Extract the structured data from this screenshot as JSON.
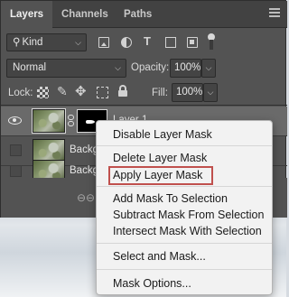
{
  "tabs": [
    {
      "label": "Layers",
      "active": true
    },
    {
      "label": "Channels",
      "active": false
    },
    {
      "label": "Paths",
      "active": false
    }
  ],
  "filter": {
    "kind_label": "Kind",
    "search_icon": "search-icon"
  },
  "blend": {
    "mode": "Normal",
    "opacity_label": "Opacity:",
    "opacity_value": "100%"
  },
  "lock": {
    "label": "Lock:",
    "fill_label": "Fill:",
    "fill_value": "100%"
  },
  "layers": [
    {
      "name": "Layer 1",
      "visible": true,
      "selected": true,
      "has_mask": true
    },
    {
      "name": "Backg",
      "visible": false,
      "selected": false,
      "has_mask": false
    },
    {
      "name": "Backg",
      "visible": false,
      "selected": false,
      "has_mask": false
    }
  ],
  "context_menu": {
    "items": [
      "Disable Layer Mask",
      "Delete Layer Mask",
      "Apply Layer Mask",
      "Add Mask To Selection",
      "Subtract Mask From Selection",
      "Intersect Mask With Selection",
      "Select and Mask...",
      "Mask Options..."
    ],
    "highlighted_item": "Apply Layer Mask",
    "highlight_color": "#c0504d"
  },
  "colors": {
    "panel_bg": "#535353",
    "tab_bar_bg": "#424242",
    "menu_bg": "#f2f2f2"
  }
}
